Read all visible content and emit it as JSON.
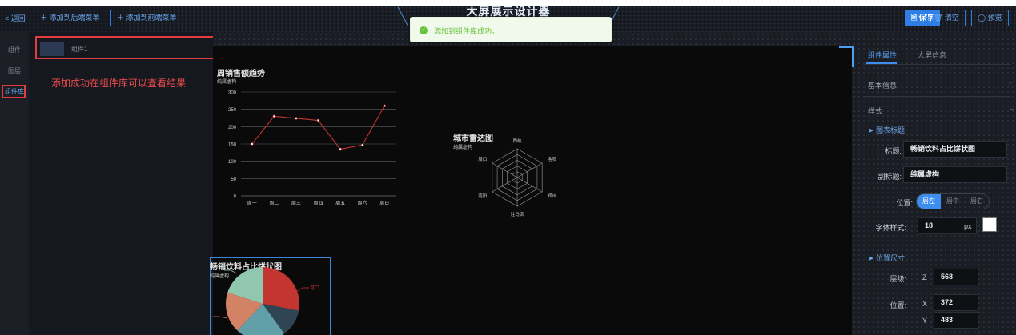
{
  "header": {
    "back_label": "< 返回",
    "add_back_menu": "＋ 添加到后端菜单",
    "add_front_menu": "＋ 添加到前端菜单",
    "title": "大屏展示设计器",
    "save": "🖹 保存",
    "clear": "🗑 清空",
    "preview": "◯ 预览"
  },
  "toast": {
    "message": "添加到组件库成功。"
  },
  "rail": {
    "items": [
      "组件",
      "图层",
      "组件库"
    ]
  },
  "library": {
    "item_name": "组件1"
  },
  "annotation": {
    "note": "添加成功在组件库可以查看结果"
  },
  "line_chart": {
    "title": "周销售额趋势",
    "subtitle": "纯属虚构",
    "chart_data": {
      "type": "line",
      "categories": [
        "周一",
        "周二",
        "周三",
        "周四",
        "周五",
        "周六",
        "周日"
      ],
      "values": [
        150,
        230,
        224,
        218,
        135,
        147,
        260
      ],
      "ylim": [
        0,
        300
      ],
      "yticks": [
        0,
        50,
        100,
        150,
        200,
        250,
        300
      ],
      "color": "#c23531"
    }
  },
  "radar_chart": {
    "title": "城市雷达图",
    "subtitle": "纯属虚构",
    "indicators": [
      "西峡",
      "洛阳",
      "郑州",
      "驻马店",
      "南阳",
      "周口"
    ]
  },
  "pie_chart": {
    "title": "畅销饮料占比饼状图",
    "subtitle": "纯属虚构",
    "visible_labels": [
      "可口...",
      "饮"
    ],
    "colors": [
      "#c23531",
      "#2f4554",
      "#61a0a8",
      "#d48265",
      "#91c7ae"
    ]
  },
  "props": {
    "tabs": [
      "组件属性",
      "大屏信息"
    ],
    "basic_info": "基本信息",
    "style": "样式",
    "chart_title_section": "➤ 图表标题",
    "title_label": "标题:",
    "title_value": "畅销饮料占比饼状图",
    "subtitle_label": "副标题:",
    "subtitle_value": "纯属虚构",
    "position_label": "位置:",
    "position_options": [
      "居左",
      "居中",
      "居右"
    ],
    "font_label": "字体样式:",
    "font_size": "18",
    "font_unit": "px",
    "pos_size_section": "➤ 位置尺寸",
    "layer_label": "层级:",
    "z_prefix": "Z",
    "z_value": "568",
    "pos_label": "位置:",
    "x_prefix": "X",
    "x_value": "372",
    "y_prefix": "Y",
    "y_value": "483"
  }
}
